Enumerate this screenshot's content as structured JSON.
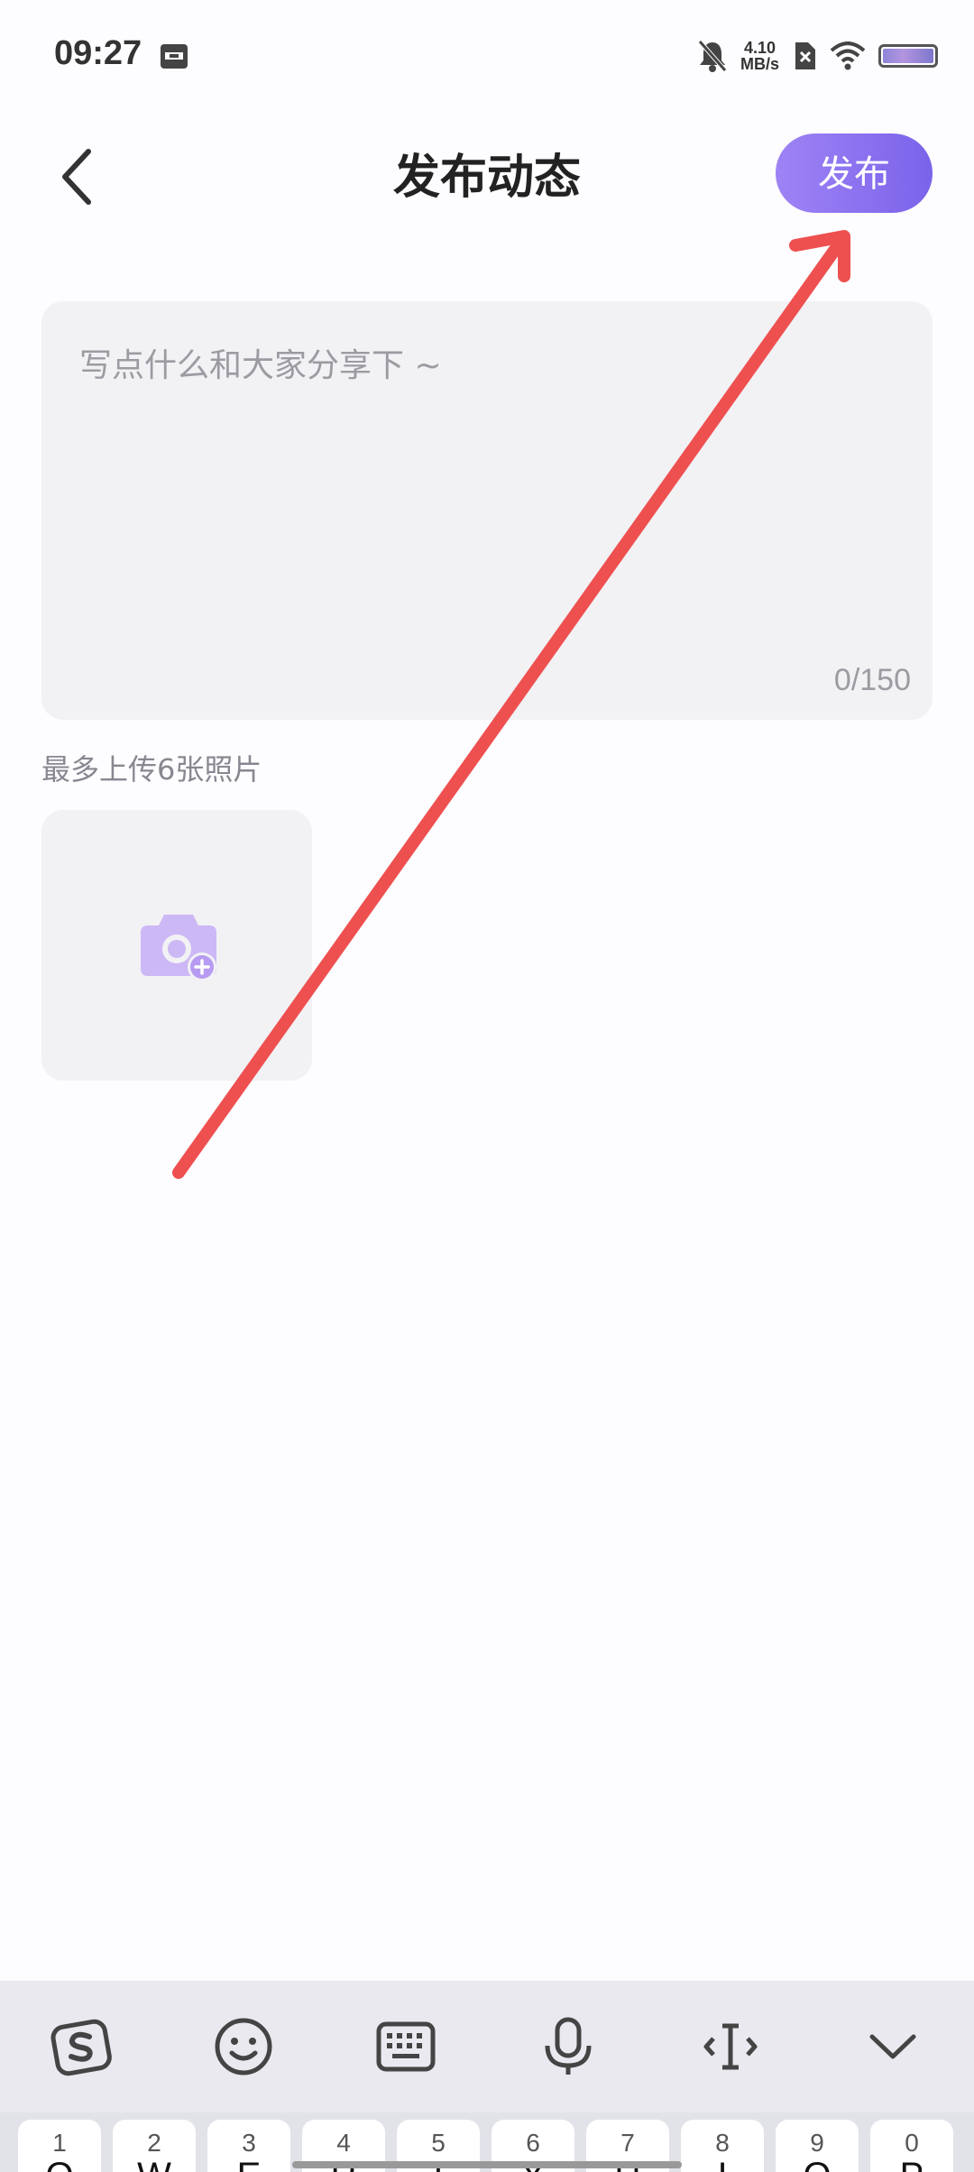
{
  "status_bar": {
    "time": "09:27",
    "net_speed_value": "4.10",
    "net_speed_unit": "MB/s",
    "icons": [
      "calendar-icon",
      "mute-bell-icon",
      "sim-off-icon",
      "wifi-icon",
      "battery-icon"
    ]
  },
  "header": {
    "title": "发布动态",
    "publish_label": "发布",
    "back_icon": "back-chevron-icon"
  },
  "post": {
    "placeholder": "写点什么和大家分享下 ~",
    "char_count": "0/150"
  },
  "photos": {
    "hint": "最多上传6张照片",
    "add_icon": "camera-add-icon"
  },
  "annotation": {
    "arrow_color": "#ee5050"
  },
  "colors": {
    "accent_start": "#9e83f5",
    "accent_end": "#7b63ea",
    "input_bg": "#f2f1f4"
  },
  "keyboard": {
    "toolbar": [
      "sogou-logo-icon",
      "emoji-icon",
      "keyboard-icon",
      "microphone-icon",
      "text-cursor-icon",
      "collapse-chevron-icon"
    ],
    "keys": [
      {
        "num": "1",
        "letter": "Q"
      },
      {
        "num": "2",
        "letter": "W"
      },
      {
        "num": "3",
        "letter": "E"
      },
      {
        "num": "4",
        "letter": "R"
      },
      {
        "num": "5",
        "letter": "T"
      },
      {
        "num": "6",
        "letter": "Y"
      },
      {
        "num": "7",
        "letter": "U"
      },
      {
        "num": "8",
        "letter": "I"
      },
      {
        "num": "9",
        "letter": "O"
      },
      {
        "num": "0",
        "letter": "P"
      }
    ]
  }
}
